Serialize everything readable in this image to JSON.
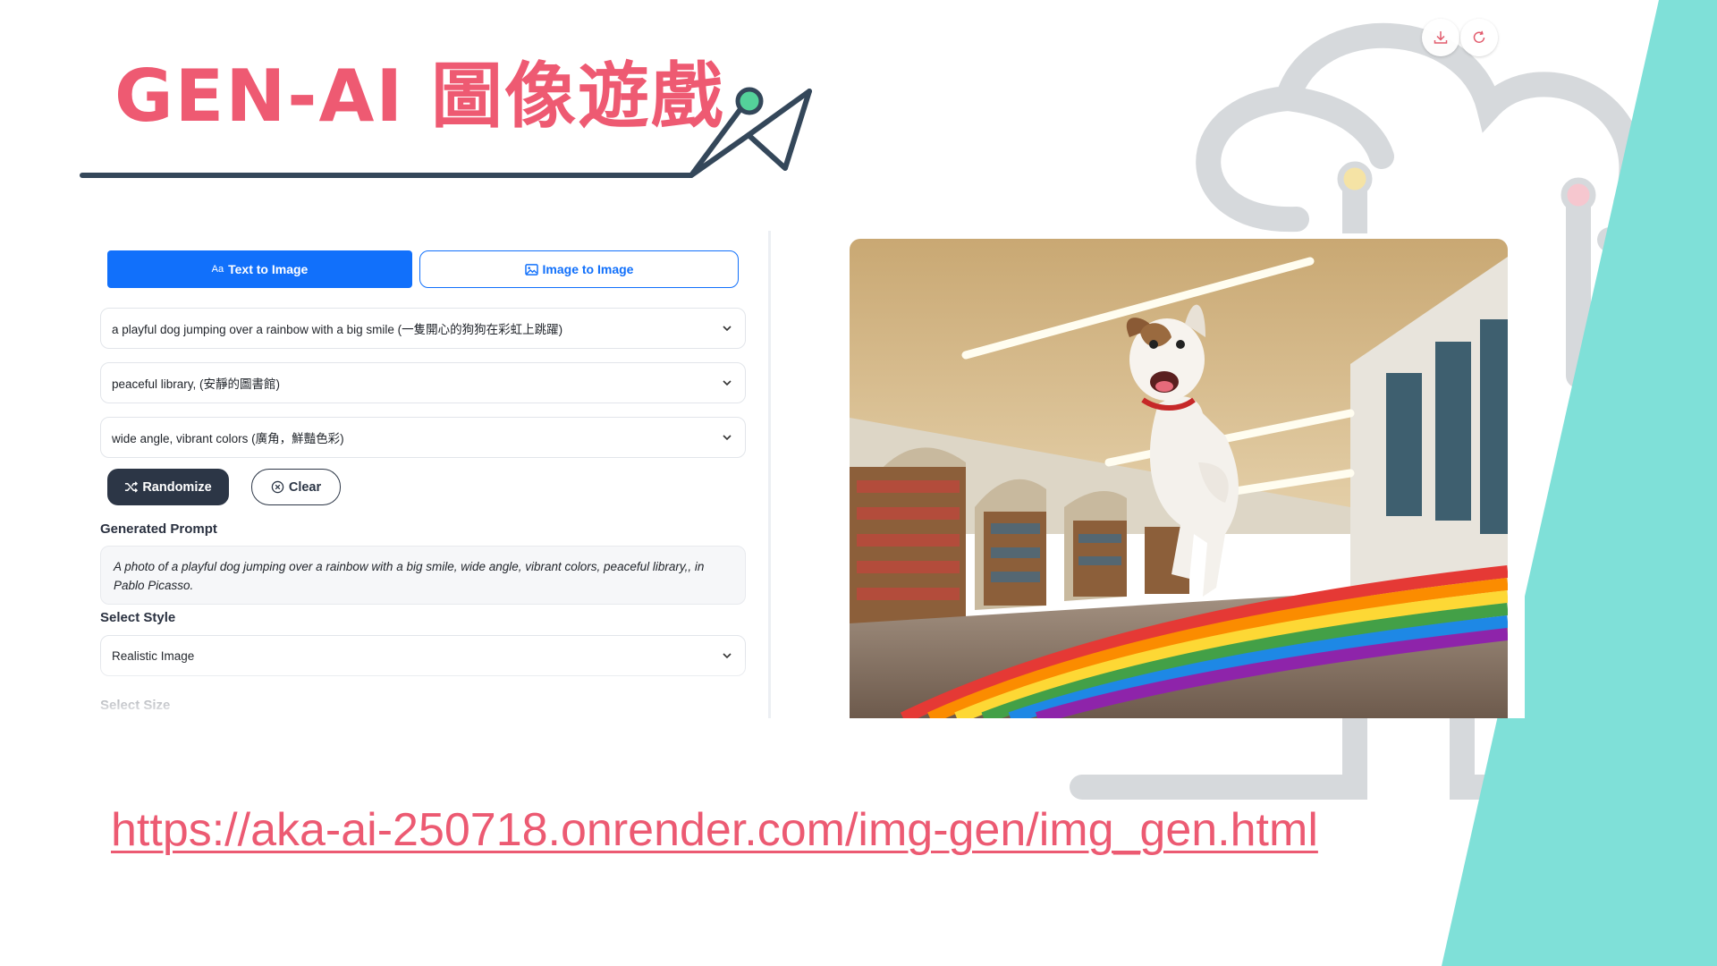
{
  "slide": {
    "title": "GEN-AI 圖像遊戲",
    "url": "https://aka-ai-250718.onrender.com/img-gen/img_gen.html"
  },
  "app": {
    "tabs": [
      {
        "icon": "Aa",
        "label": "Text to Image",
        "active": true
      },
      {
        "icon": "image-icon",
        "label": "Image to Image",
        "active": false
      }
    ],
    "subject_select": "a playful dog jumping over a rainbow with a big smile (一隻開心的狗狗在彩虹上跳躍)",
    "scene_select": "peaceful library, (安靜的圖書館)",
    "style_modifiers_select": "wide angle, vibrant colors (廣角，鮮豔色彩)",
    "randomize_label": "Randomize",
    "clear_label": "Clear",
    "generated_prompt_label": "Generated Prompt",
    "generated_prompt": "A photo of a playful dog jumping over a rainbow with a big smile, wide angle, vibrant colors, peaceful library,, in Pablo Picasso.",
    "select_style_label": "Select Style",
    "style_value": "Realistic Image",
    "select_size_label": "Select Size"
  },
  "colors": {
    "accent_blue": "#1170fb",
    "title_pink": "#ee5a72",
    "dark_button": "#2c3646",
    "teal_shape": "#7fe0d8"
  },
  "icons": {
    "download": "download-icon",
    "refresh": "refresh-icon",
    "shuffle": "shuffle-icon",
    "clear": "x-circle-icon",
    "chevron": "chevron-down-icon"
  }
}
